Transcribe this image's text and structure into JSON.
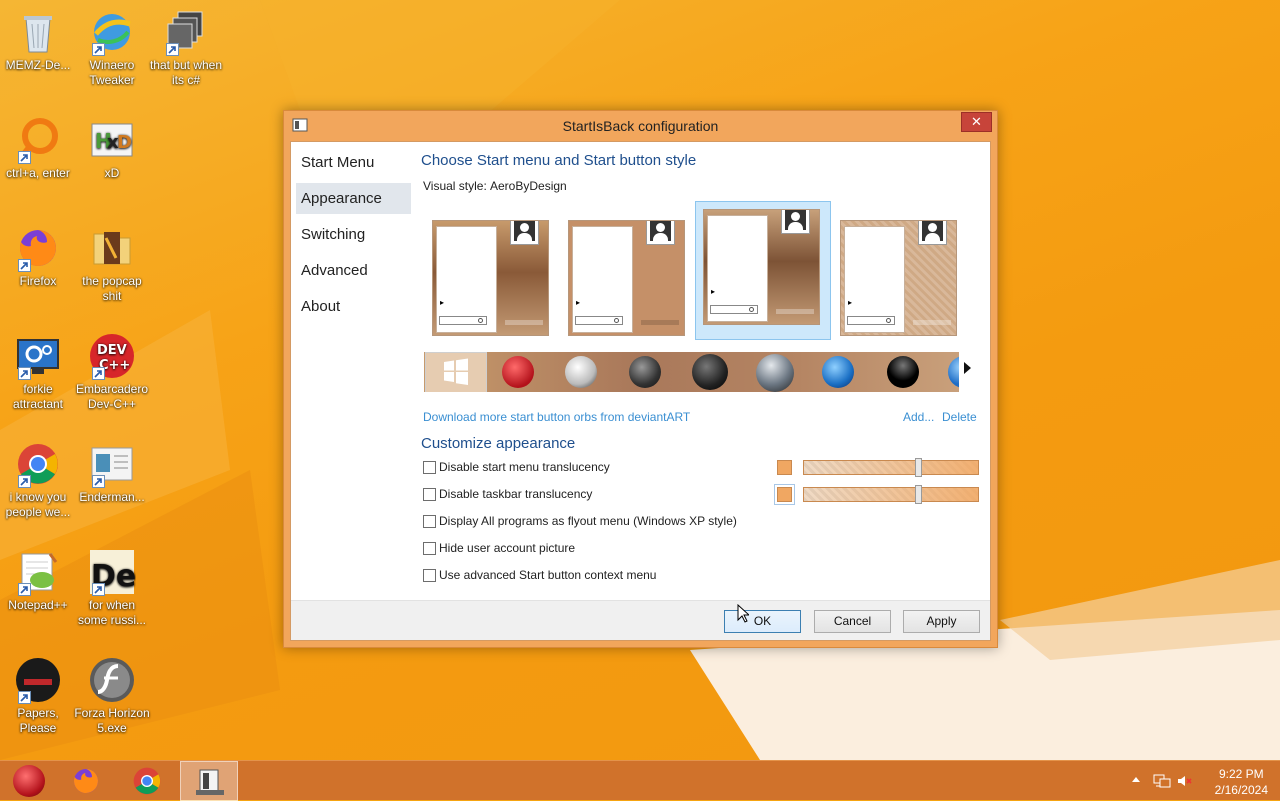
{
  "desktop": {
    "icons": [
      {
        "label": "MEMZ-De...",
        "icon": "recycle-bin-icon"
      },
      {
        "label": "Winaero Tweaker",
        "icon": "winaero-icon"
      },
      {
        "label": "that but when its c#",
        "icon": "stack-icon"
      },
      {
        "label": "ctrl+a, enter",
        "icon": "orange-ring-icon"
      },
      {
        "label": "xD",
        "icon": "hxd-icon"
      },
      {
        "label": "Firefox",
        "icon": "firefox-icon"
      },
      {
        "label": "the popcap shit",
        "icon": "folder-icon"
      },
      {
        "label": "forkie attractant",
        "icon": "monitor-gear-icon"
      },
      {
        "label": "Embarcadero Dev-C++",
        "icon": "devcpp-icon"
      },
      {
        "label": "i know you people we...",
        "icon": "chrome-icon"
      },
      {
        "label": "Enderman...",
        "icon": "document-icon"
      },
      {
        "label": "Notepad++",
        "icon": "notepadpp-icon"
      },
      {
        "label": "for when some russi...",
        "icon": "de-icon"
      },
      {
        "label": "Papers, Please",
        "icon": "papers-please-icon"
      },
      {
        "label": "Forza Horizon 5.exe",
        "icon": "flash-icon"
      }
    ]
  },
  "window": {
    "title": "StartIsBack configuration",
    "close": "✕",
    "nav": [
      {
        "label": "Start Menu"
      },
      {
        "label": "Appearance"
      },
      {
        "label": "Switching"
      },
      {
        "label": "Advanced"
      },
      {
        "label": "About"
      }
    ],
    "selected_nav": "Appearance",
    "style_heading": "Choose Start menu and Start button style",
    "visual_style_label": "Visual style:",
    "visual_style_value": "AeroByDesign",
    "style_tiles_selected_index": 2,
    "orbs": [
      "windows-flat-orb",
      "christmas-ornament-orb",
      "windows-7-white-orb",
      "windows-7-dark-orb",
      "windows-dark-glass-orb",
      "windows-silver-orb",
      "windows-blue-orb",
      "black-sphere-orb",
      "blue-partial-orb"
    ],
    "download_link": "Download more start button orbs from deviantART",
    "add_link": "Add...",
    "delete_link": "Delete",
    "customize_heading": "Customize appearance",
    "options": [
      {
        "label": "Disable start menu translucency",
        "checked": false
      },
      {
        "label": "Disable taskbar translucency",
        "checked": false
      },
      {
        "label": "Display All programs as flyout menu (Windows XP style)",
        "checked": false
      },
      {
        "label": "Hide user account picture",
        "checked": false
      },
      {
        "label": "Use advanced Start button context menu",
        "checked": false
      }
    ],
    "start_menu_color": "#f0a762",
    "taskbar_color": "#f0a762",
    "start_menu_translucency": 0.65,
    "taskbar_translucency": 0.65,
    "buttons": {
      "ok": "OK",
      "cancel": "Cancel",
      "apply": "Apply"
    }
  },
  "taskbar": {
    "pinned": [
      "christmas-ornament-start-icon",
      "firefox-icon",
      "chrome-icon",
      "startisback-config-icon"
    ],
    "time": "9:22 PM",
    "date": "2/16/2024",
    "tray": [
      "show-hidden-icons-arrow",
      "network-icon",
      "volume-muted-icon"
    ]
  }
}
